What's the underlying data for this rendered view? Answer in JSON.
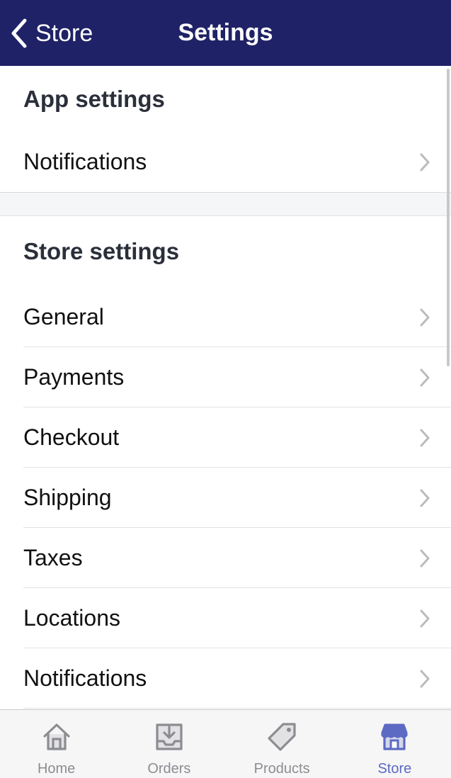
{
  "nav": {
    "back_label": "Store",
    "title": "Settings",
    "back_icon": "chevron-left-icon",
    "bar_color": "#1f2266"
  },
  "app_settings": {
    "header": "App settings",
    "items": [
      {
        "label": "Notifications"
      }
    ]
  },
  "store_settings": {
    "header": "Store settings",
    "items": [
      {
        "label": "General"
      },
      {
        "label": "Payments"
      },
      {
        "label": "Checkout"
      },
      {
        "label": "Shipping"
      },
      {
        "label": "Taxes"
      },
      {
        "label": "Locations"
      },
      {
        "label": "Notifications"
      }
    ]
  },
  "tabbar": {
    "active": "Store",
    "active_color": "#5c6ac4",
    "inactive_color": "#8b8d91",
    "tabs": [
      {
        "label": "Home",
        "icon": "home-icon"
      },
      {
        "label": "Orders",
        "icon": "orders-inbox-icon"
      },
      {
        "label": "Products",
        "icon": "tag-icon"
      },
      {
        "label": "Store",
        "icon": "storefront-icon"
      }
    ]
  }
}
